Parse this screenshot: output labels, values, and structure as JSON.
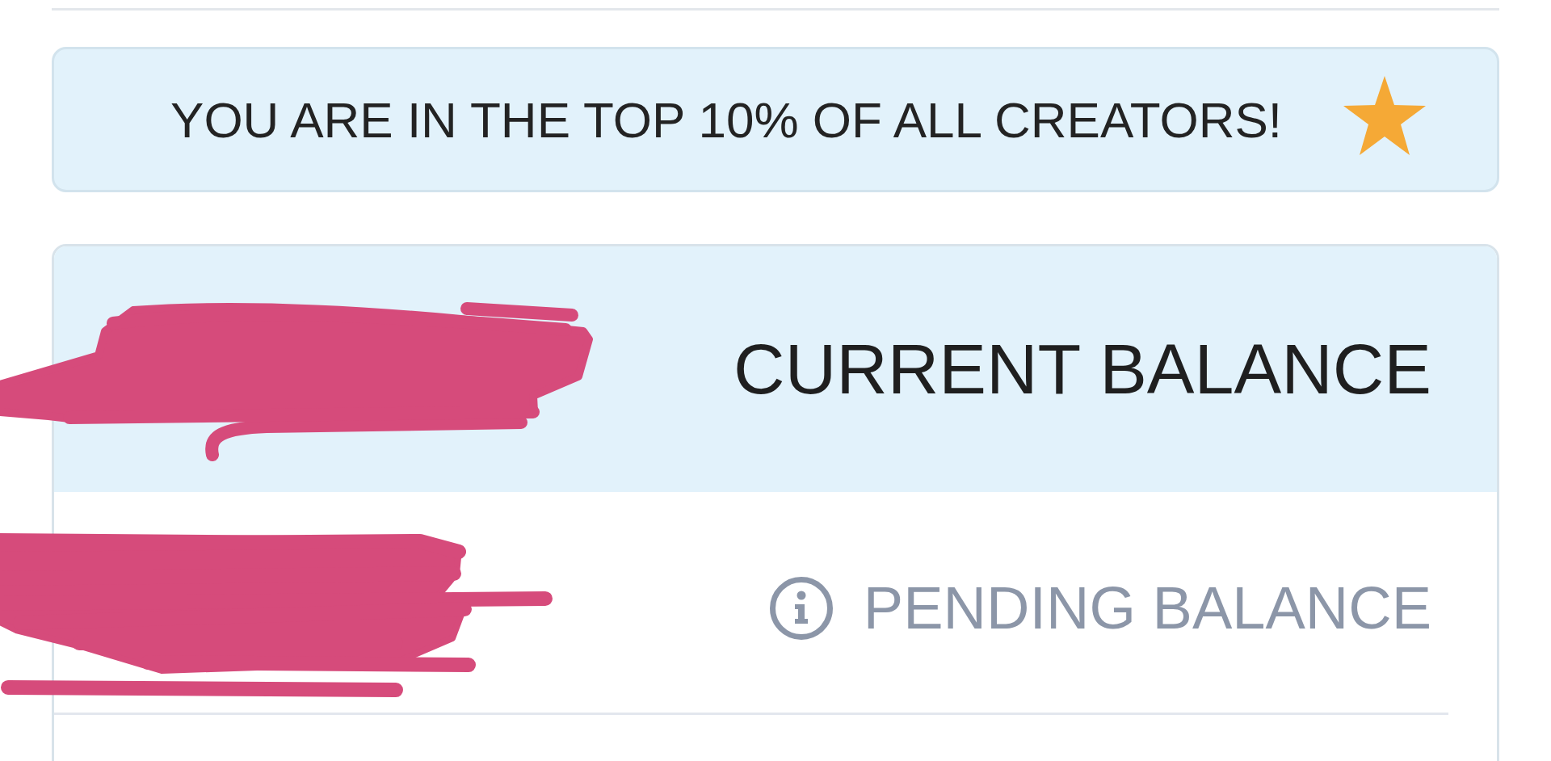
{
  "banner": {
    "text": "YOU ARE IN THE TOP 10% OF ALL CREATORS!"
  },
  "balance_card": {
    "header": {
      "label": "CURRENT BALANCE"
    },
    "rows": [
      {
        "label": "PENDING BALANCE",
        "info": true
      }
    ]
  }
}
